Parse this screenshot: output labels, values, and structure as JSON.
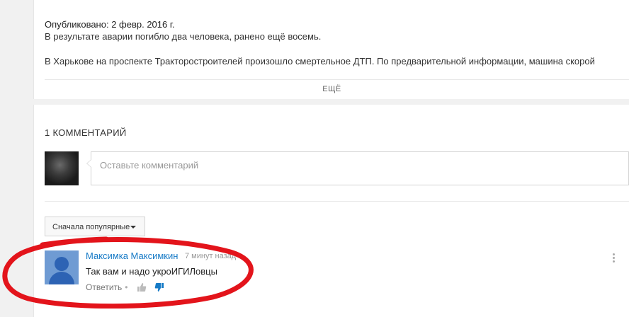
{
  "description": {
    "published": "Опубликовано: 2 февр. 2016 г.",
    "line1": "В результате аварии погибло два человека, ранено ещё восемь.",
    "line2": "В Харькове на проспекте Тракторостроителей произошло смертельное ДТП. По предварительной информации, машина скорой",
    "more_label": "ЕЩЁ"
  },
  "comments": {
    "count_label": "1 КОММЕНТАРИЙ",
    "input_placeholder": "Оставьте комментарий",
    "sort_label": "Сначала популярные",
    "items": [
      {
        "author": "Максимка Максимкин",
        "time": "7 минут назад",
        "text": "Так вам и надо укроИГИЛовцы",
        "reply_label": "Ответить"
      }
    ]
  },
  "colors": {
    "link": "#167ac6",
    "annotation": "#e3141b"
  }
}
